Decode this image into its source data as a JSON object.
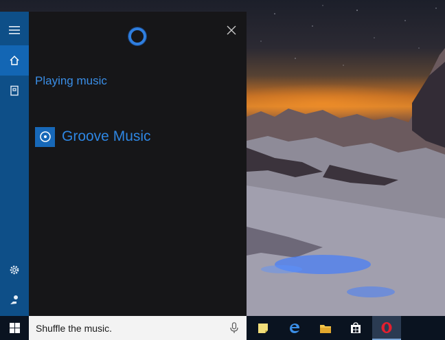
{
  "panel": {
    "heading": "Playing music",
    "result_app": "Groove Music"
  },
  "search": {
    "value": "Shuffle the music."
  },
  "icons": {
    "menu": "hamburger-icon",
    "home": "home-icon",
    "notebook": "notebook-icon",
    "settings": "gear-icon",
    "feedback": "feedback-icon",
    "cortana": "cortana-ring-icon",
    "close": "close-icon",
    "groove": "groove-music-icon",
    "start": "windows-logo-icon",
    "mic": "microphone-icon"
  },
  "taskbar": {
    "apps": [
      "sticky-notes",
      "edge",
      "file-explorer",
      "store",
      "opera"
    ]
  },
  "colors": {
    "accent": "#1366b4",
    "rail": "#0e4f88",
    "panel": "#161618",
    "link_blue": "#3a8ee6",
    "taskbar": "#0a1320"
  }
}
